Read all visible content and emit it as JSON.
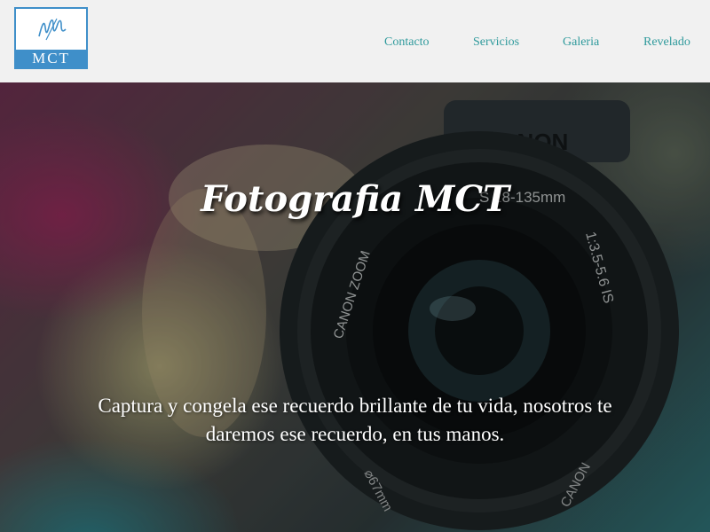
{
  "header": {
    "logo": {
      "text": "MCT",
      "mark": "m-script-logo-icon",
      "color": "#3f8fc9"
    },
    "nav": [
      {
        "label": "Contacto"
      },
      {
        "label": "Servicios"
      },
      {
        "label": "Galeria"
      },
      {
        "label": "Revelado"
      }
    ],
    "nav_color": "#2f9a9c"
  },
  "hero": {
    "title": "Fotografia MCT",
    "text": "Captura y congela ese recuerdo brillante de tu vida, nosotros te daremos ese recuerdo, en tus manos.",
    "background": "camera-lens-photo",
    "lens_text": {
      "top_ring": "S 18-135mm",
      "side_ring": "1:3.5-5.6 IS",
      "left_ring": "CANON ZOOM",
      "brand": "CANON",
      "bottom_ring": "⌀67mm",
      "bottom_brand": "CANON"
    }
  }
}
